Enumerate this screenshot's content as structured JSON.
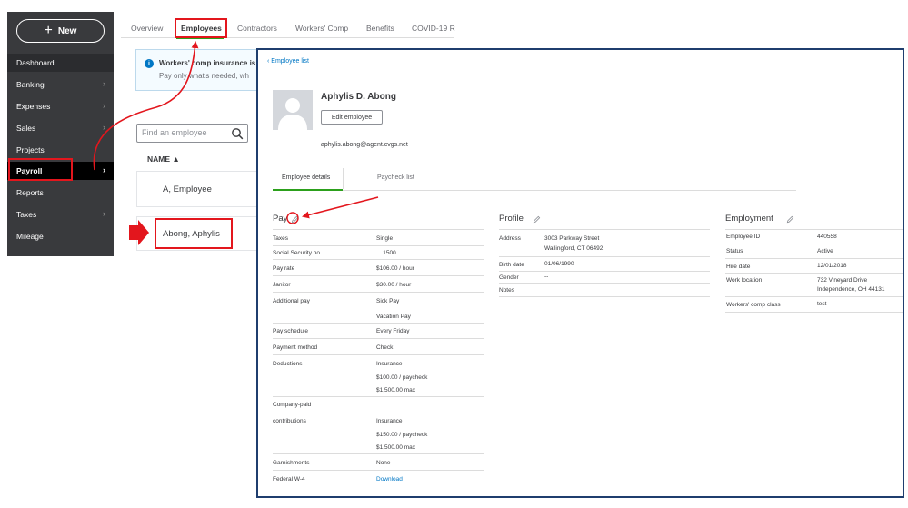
{
  "sidebar": {
    "new_label": "New",
    "items": [
      {
        "label": "Dashboard",
        "chevron": false
      },
      {
        "label": "Banking",
        "chevron": true
      },
      {
        "label": "Expenses",
        "chevron": true
      },
      {
        "label": "Sales",
        "chevron": true
      },
      {
        "label": "Projects",
        "chevron": false
      },
      {
        "label": "Payroll",
        "chevron": true
      },
      {
        "label": "Reports",
        "chevron": false
      },
      {
        "label": "Taxes",
        "chevron": true
      },
      {
        "label": "Mileage",
        "chevron": false
      }
    ]
  },
  "tabs": [
    "Overview",
    "Employees",
    "Contractors",
    "Workers' Comp",
    "Benefits",
    "COVID-19 R"
  ],
  "banner": {
    "title": "Workers' comp insurance is",
    "body": "Pay only what's needed, wh"
  },
  "search": {
    "placeholder": "Find an employee"
  },
  "list": {
    "header": "NAME ▲",
    "rows": [
      "A, Employee",
      "Abong, Aphylis"
    ]
  },
  "detail": {
    "back_link": "‹ Employee list",
    "name": "Aphylis D. Abong",
    "edit_label": "Edit employee",
    "email": "aphylis.abong@agent.cvgs.net",
    "tabs": [
      "Employee details",
      "Paycheck list"
    ],
    "pay": {
      "title": "Pay",
      "rows": [
        {
          "label": "Taxes",
          "values": [
            "Single"
          ]
        },
        {
          "label": "Social Security no.",
          "values": [
            "....1500"
          ]
        },
        {
          "label": "Pay rate",
          "values": [
            "$106.00 / hour"
          ]
        },
        {
          "label": "Janitor",
          "values": [
            "$30.00 / hour"
          ]
        },
        {
          "label": "Additional pay",
          "values": [
            "Sick Pay",
            "Vacation Pay"
          ]
        },
        {
          "label": "Pay schedule",
          "values": [
            "Every Friday"
          ]
        },
        {
          "label": "Payment method",
          "values": [
            "Check"
          ]
        },
        {
          "label": "Deductions",
          "values": [
            "Insurance",
            "$100.00 / paycheck",
            "$1,500.00 max"
          ]
        },
        {
          "label": "Company-paid",
          "values": []
        },
        {
          "label": "contributions",
          "values": [
            "Insurance",
            "$150.00 / paycheck",
            "$1,500.00 max"
          ]
        },
        {
          "label": "Garnishments",
          "values": [
            "None"
          ]
        },
        {
          "label": "Federal W-4",
          "values": [
            "Download"
          ]
        }
      ]
    },
    "profile": {
      "title": "Profile",
      "rows": [
        {
          "label": "Address",
          "values": [
            "3003 Parkway Street",
            "Wallingford, CT 06492"
          ]
        },
        {
          "label": "Birth date",
          "values": [
            "01/06/1990"
          ]
        },
        {
          "label": "Gender",
          "values": [
            "--"
          ]
        },
        {
          "label": "Notes",
          "values": []
        }
      ]
    },
    "employment": {
      "title": "Employment",
      "rows": [
        {
          "label": "Employee ID",
          "values": [
            "440558"
          ]
        },
        {
          "label": "Status",
          "values": [
            "Active"
          ]
        },
        {
          "label": "Hire date",
          "values": [
            "12/01/2018"
          ]
        },
        {
          "label": "Work location",
          "values": [
            "732 Vineyard Drive",
            "Independence, OH 44131"
          ]
        },
        {
          "label": "Workers' comp class",
          "values": [
            "test"
          ]
        }
      ]
    }
  },
  "colors": {
    "sidebar_bg": "#393a3d",
    "accent_green": "#2ca01c",
    "link_blue": "#0077c5",
    "annotation_red": "#e3161d",
    "panel_border": "#1f3e6e"
  }
}
